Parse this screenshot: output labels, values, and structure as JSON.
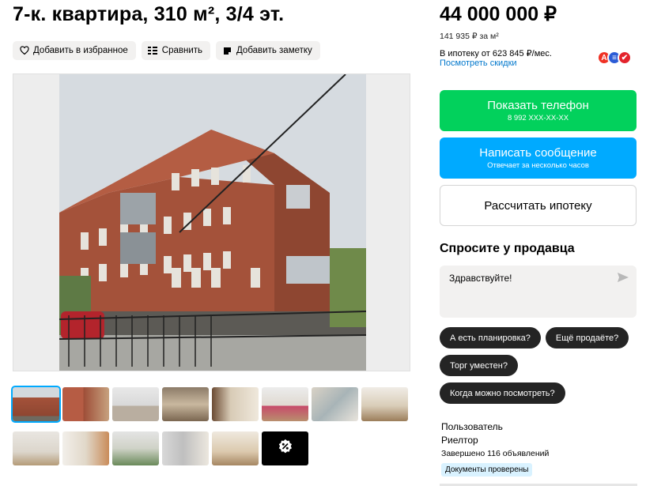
{
  "listing": {
    "title": "7-к. квартира, 310 м², 3/4 эт.",
    "actions": {
      "favorite": "Добавить в избранное",
      "compare": "Сравнить",
      "note": "Добавить заметку"
    },
    "photo_count_more_icon": "percent-more-icon"
  },
  "price": {
    "value": "44 000 000 ₽",
    "per_m2": "141 935 ₽ за м²",
    "mortgage": "В ипотеку от 623 845 ₽/мес.",
    "discount_link": "Посмотреть скидки",
    "banks": [
      "А",
      "≡",
      "✔"
    ]
  },
  "contact": {
    "show_phone": "Показать телефон",
    "phone_masked": "8 992 XXX-XX-XX",
    "write_message": "Написать сообщение",
    "reply_time": "Отвечает за несколько часов",
    "mortgage_calc": "Рассчитать ипотеку"
  },
  "ask": {
    "title": "Спросите у продавца",
    "message": "Здравствуйте!",
    "chips": [
      "А есть планировка?",
      "Ещё продаёте?",
      "Торг уместен?",
      "Когда можно посмотреть?"
    ]
  },
  "seller": {
    "name": "Пользователь",
    "type": "Риелтор",
    "completed": "Завершено 116 объявлений",
    "badge": "Документы проверены"
  },
  "colors": {
    "green": "#02d15c",
    "blue": "#00aaff",
    "chip": "#242424",
    "link": "#0077cc"
  }
}
